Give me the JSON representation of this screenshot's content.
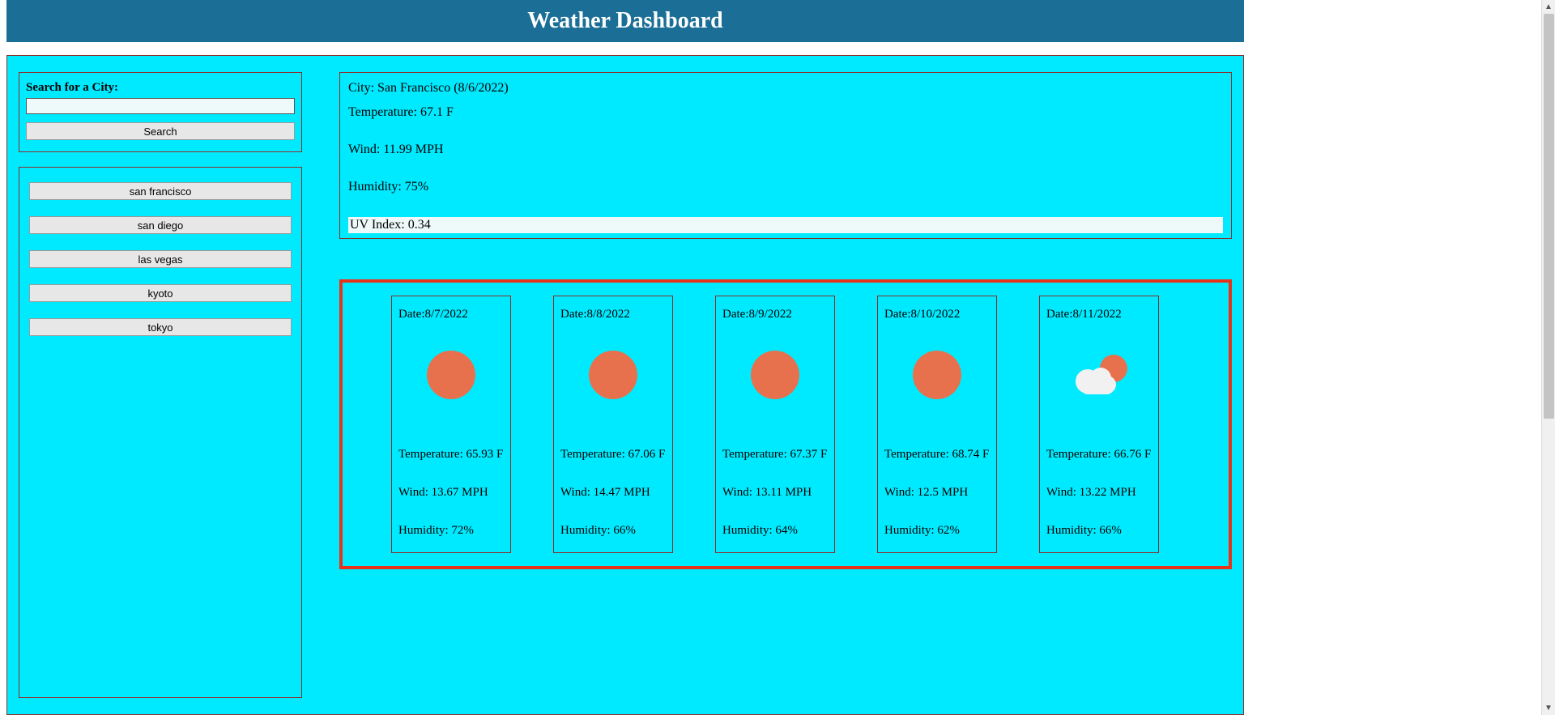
{
  "header": {
    "title": "Weather Dashboard"
  },
  "search": {
    "label": "Search for a City:",
    "value": "",
    "button": "Search"
  },
  "history": [
    "san francisco",
    "san diego",
    "las vegas",
    "kyoto",
    "tokyo"
  ],
  "current": {
    "city_line": "City: San Francisco (8/6/2022)",
    "temp": "Temperature: 67.1 F",
    "wind": "Wind: 11.99 MPH",
    "humidity": "Humidity: 75%",
    "uv": "UV Index: 0.34"
  },
  "forecast": [
    {
      "date": "Date:8/7/2022",
      "icon": "sun",
      "temp": "Temperature: 65.93 F",
      "wind": "Wind: 13.67 MPH",
      "humidity": "Humidity: 72%"
    },
    {
      "date": "Date:8/8/2022",
      "icon": "sun",
      "temp": "Temperature: 67.06 F",
      "wind": "Wind: 14.47 MPH",
      "humidity": "Humidity: 66%"
    },
    {
      "date": "Date:8/9/2022",
      "icon": "sun",
      "temp": "Temperature: 67.37 F",
      "wind": "Wind: 13.11 MPH",
      "humidity": "Humidity: 64%"
    },
    {
      "date": "Date:8/10/2022",
      "icon": "sun",
      "temp": "Temperature: 68.74 F",
      "wind": "Wind: 12.5 MPH",
      "humidity": "Humidity: 62%"
    },
    {
      "date": "Date:8/11/2022",
      "icon": "cloudsun",
      "temp": "Temperature: 66.76 F",
      "wind": "Wind: 13.22 MPH",
      "humidity": "Humidity: 66%"
    }
  ]
}
